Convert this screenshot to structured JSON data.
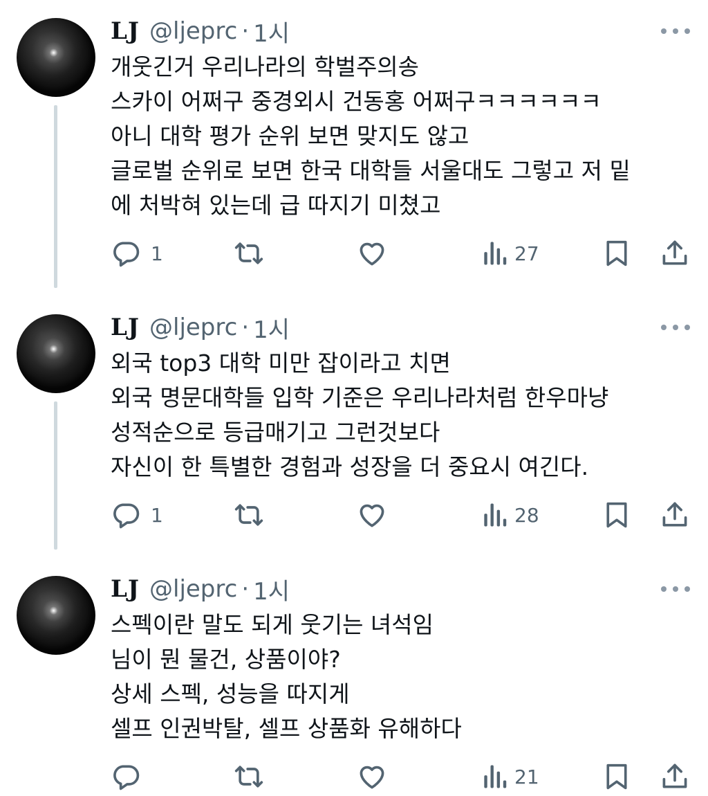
{
  "colors": {
    "text": "#0f1419",
    "secondary": "#536471",
    "thread_line": "#cfd9de"
  },
  "tweets": [
    {
      "name": "LJ",
      "handle": "@ljeprc",
      "dot": "·",
      "time": "1시",
      "lines": [
        "개웃긴거 우리나라의 학벌주의송",
        "스카이 어쩌구 중경외시 건동홍 어쩌구ㅋㅋㅋㅋㅋㅋ",
        "아니 대학 평가 순위 보면 맞지도 않고",
        "글로벌 순위로 보면 한국 대학들 서울대도 그렇고 저 밑",
        "에 처박혀 있는데 급 따지기 미쳤고"
      ],
      "replies": "1",
      "retweets": "",
      "likes": "",
      "views": "27"
    },
    {
      "name": "LJ",
      "handle": "@ljeprc",
      "dot": "·",
      "time": "1시",
      "lines": [
        "외국 top3 대학 미만 잡이라고 치면",
        "외국 명문대학들 입학 기준은 우리나라처럼 한우마냥",
        "성적순으로 등급매기고 그런것보다",
        "자신이 한 특별한 경험과 성장을 더 중요시 여긴다."
      ],
      "replies": "1",
      "retweets": "",
      "likes": "",
      "views": "28"
    },
    {
      "name": "LJ",
      "handle": "@ljeprc",
      "dot": "·",
      "time": "1시",
      "lines": [
        "스펙이란 말도 되게 웃기는 녀석임",
        "님이 뭔 물건, 상품이야?",
        "상세 스펙, 성능을 따지게",
        "셀프 인권박탈, 셀프 상품화 유해하다"
      ],
      "replies": "",
      "retweets": "",
      "likes": "",
      "views": "21"
    }
  ],
  "icons": {
    "reply": "reply-icon",
    "retweet": "retweet-icon",
    "like": "heart-icon",
    "views": "views-icon",
    "bookmark": "bookmark-icon",
    "share": "share-icon",
    "more": "more-icon"
  }
}
